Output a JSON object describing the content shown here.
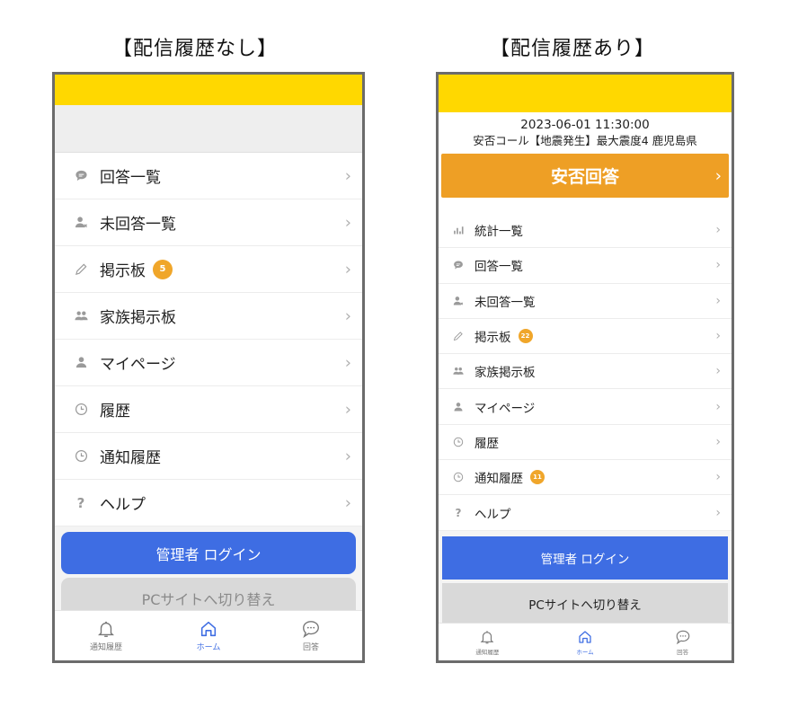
{
  "captions": {
    "left": "【配信履歴なし】",
    "right": "【配信履歴あり】"
  },
  "colors": {
    "header_yellow": "#ffd800",
    "accent_orange": "#ee9f25",
    "badge_orange": "#f0a62a",
    "admin_blue": "#3e6de3",
    "pc_button_gray": "#d9d9d9"
  },
  "left_screen": {
    "menu": [
      {
        "icon": "speech-bubble-icon",
        "label": "回答一覧"
      },
      {
        "icon": "person-x-icon",
        "label": "未回答一覧"
      },
      {
        "icon": "pencil-icon",
        "label": "掲示板",
        "badge": "5"
      },
      {
        "icon": "people-icon",
        "label": "家族掲示板"
      },
      {
        "icon": "person-icon",
        "label": "マイページ"
      },
      {
        "icon": "clock-icon",
        "label": "履歴"
      },
      {
        "icon": "clock-icon",
        "label": "通知履歴"
      },
      {
        "icon": "question-icon",
        "label": "ヘルプ"
      }
    ],
    "admin_login": "管理者 ログイン",
    "pc_switch": "PCサイトへ切り替え",
    "tabs": [
      {
        "icon": "bell-icon",
        "label": "通知履歴"
      },
      {
        "icon": "home-icon",
        "label": "ホーム",
        "active": true
      },
      {
        "icon": "chat-icon",
        "label": "回答"
      }
    ]
  },
  "right_screen": {
    "alert": {
      "datetime": "2023-06-01 11:30:00",
      "message": "安否コール【地震発生】最大震度4 鹿児島県",
      "button": "安否回答"
    },
    "menu": [
      {
        "icon": "bar-chart-icon",
        "label": "統計一覧"
      },
      {
        "icon": "speech-bubble-icon",
        "label": "回答一覧"
      },
      {
        "icon": "person-x-icon",
        "label": "未回答一覧"
      },
      {
        "icon": "pencil-icon",
        "label": "掲示板",
        "badge": "22"
      },
      {
        "icon": "people-icon",
        "label": "家族掲示板"
      },
      {
        "icon": "person-icon",
        "label": "マイページ"
      },
      {
        "icon": "clock-icon",
        "label": "履歴"
      },
      {
        "icon": "clock-icon",
        "label": "通知履歴",
        "badge": "11"
      },
      {
        "icon": "question-icon",
        "label": "ヘルプ"
      }
    ],
    "admin_login": "管理者 ログイン",
    "pc_switch": "PCサイトへ切り替え",
    "tabs": [
      {
        "icon": "bell-icon",
        "label": "通知履歴"
      },
      {
        "icon": "home-icon",
        "label": "ホーム",
        "active": true
      },
      {
        "icon": "chat-icon",
        "label": "回答"
      }
    ]
  },
  "chevron": "›"
}
